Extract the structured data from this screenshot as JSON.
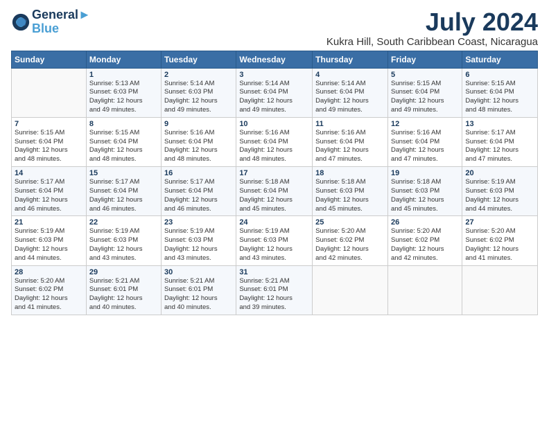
{
  "logo": {
    "line1": "General",
    "line2": "Blue"
  },
  "title": "July 2024",
  "location": "Kukra Hill, South Caribbean Coast, Nicaragua",
  "days_of_week": [
    "Sunday",
    "Monday",
    "Tuesday",
    "Wednesday",
    "Thursday",
    "Friday",
    "Saturday"
  ],
  "weeks": [
    [
      {
        "day": "",
        "sunrise": "",
        "sunset": "",
        "daylight": ""
      },
      {
        "day": "1",
        "sunrise": "Sunrise: 5:13 AM",
        "sunset": "Sunset: 6:03 PM",
        "daylight": "Daylight: 12 hours and 49 minutes."
      },
      {
        "day": "2",
        "sunrise": "Sunrise: 5:14 AM",
        "sunset": "Sunset: 6:03 PM",
        "daylight": "Daylight: 12 hours and 49 minutes."
      },
      {
        "day": "3",
        "sunrise": "Sunrise: 5:14 AM",
        "sunset": "Sunset: 6:04 PM",
        "daylight": "Daylight: 12 hours and 49 minutes."
      },
      {
        "day": "4",
        "sunrise": "Sunrise: 5:14 AM",
        "sunset": "Sunset: 6:04 PM",
        "daylight": "Daylight: 12 hours and 49 minutes."
      },
      {
        "day": "5",
        "sunrise": "Sunrise: 5:15 AM",
        "sunset": "Sunset: 6:04 PM",
        "daylight": "Daylight: 12 hours and 49 minutes."
      },
      {
        "day": "6",
        "sunrise": "Sunrise: 5:15 AM",
        "sunset": "Sunset: 6:04 PM",
        "daylight": "Daylight: 12 hours and 48 minutes."
      }
    ],
    [
      {
        "day": "7",
        "sunrise": "Sunrise: 5:15 AM",
        "sunset": "Sunset: 6:04 PM",
        "daylight": "Daylight: 12 hours and 48 minutes."
      },
      {
        "day": "8",
        "sunrise": "Sunrise: 5:15 AM",
        "sunset": "Sunset: 6:04 PM",
        "daylight": "Daylight: 12 hours and 48 minutes."
      },
      {
        "day": "9",
        "sunrise": "Sunrise: 5:16 AM",
        "sunset": "Sunset: 6:04 PM",
        "daylight": "Daylight: 12 hours and 48 minutes."
      },
      {
        "day": "10",
        "sunrise": "Sunrise: 5:16 AM",
        "sunset": "Sunset: 6:04 PM",
        "daylight": "Daylight: 12 hours and 48 minutes."
      },
      {
        "day": "11",
        "sunrise": "Sunrise: 5:16 AM",
        "sunset": "Sunset: 6:04 PM",
        "daylight": "Daylight: 12 hours and 47 minutes."
      },
      {
        "day": "12",
        "sunrise": "Sunrise: 5:16 AM",
        "sunset": "Sunset: 6:04 PM",
        "daylight": "Daylight: 12 hours and 47 minutes."
      },
      {
        "day": "13",
        "sunrise": "Sunrise: 5:17 AM",
        "sunset": "Sunset: 6:04 PM",
        "daylight": "Daylight: 12 hours and 47 minutes."
      }
    ],
    [
      {
        "day": "14",
        "sunrise": "Sunrise: 5:17 AM",
        "sunset": "Sunset: 6:04 PM",
        "daylight": "Daylight: 12 hours and 46 minutes."
      },
      {
        "day": "15",
        "sunrise": "Sunrise: 5:17 AM",
        "sunset": "Sunset: 6:04 PM",
        "daylight": "Daylight: 12 hours and 46 minutes."
      },
      {
        "day": "16",
        "sunrise": "Sunrise: 5:17 AM",
        "sunset": "Sunset: 6:04 PM",
        "daylight": "Daylight: 12 hours and 46 minutes."
      },
      {
        "day": "17",
        "sunrise": "Sunrise: 5:18 AM",
        "sunset": "Sunset: 6:04 PM",
        "daylight": "Daylight: 12 hours and 45 minutes."
      },
      {
        "day": "18",
        "sunrise": "Sunrise: 5:18 AM",
        "sunset": "Sunset: 6:03 PM",
        "daylight": "Daylight: 12 hours and 45 minutes."
      },
      {
        "day": "19",
        "sunrise": "Sunrise: 5:18 AM",
        "sunset": "Sunset: 6:03 PM",
        "daylight": "Daylight: 12 hours and 45 minutes."
      },
      {
        "day": "20",
        "sunrise": "Sunrise: 5:19 AM",
        "sunset": "Sunset: 6:03 PM",
        "daylight": "Daylight: 12 hours and 44 minutes."
      }
    ],
    [
      {
        "day": "21",
        "sunrise": "Sunrise: 5:19 AM",
        "sunset": "Sunset: 6:03 PM",
        "daylight": "Daylight: 12 hours and 44 minutes."
      },
      {
        "day": "22",
        "sunrise": "Sunrise: 5:19 AM",
        "sunset": "Sunset: 6:03 PM",
        "daylight": "Daylight: 12 hours and 43 minutes."
      },
      {
        "day": "23",
        "sunrise": "Sunrise: 5:19 AM",
        "sunset": "Sunset: 6:03 PM",
        "daylight": "Daylight: 12 hours and 43 minutes."
      },
      {
        "day": "24",
        "sunrise": "Sunrise: 5:19 AM",
        "sunset": "Sunset: 6:03 PM",
        "daylight": "Daylight: 12 hours and 43 minutes."
      },
      {
        "day": "25",
        "sunrise": "Sunrise: 5:20 AM",
        "sunset": "Sunset: 6:02 PM",
        "daylight": "Daylight: 12 hours and 42 minutes."
      },
      {
        "day": "26",
        "sunrise": "Sunrise: 5:20 AM",
        "sunset": "Sunset: 6:02 PM",
        "daylight": "Daylight: 12 hours and 42 minutes."
      },
      {
        "day": "27",
        "sunrise": "Sunrise: 5:20 AM",
        "sunset": "Sunset: 6:02 PM",
        "daylight": "Daylight: 12 hours and 41 minutes."
      }
    ],
    [
      {
        "day": "28",
        "sunrise": "Sunrise: 5:20 AM",
        "sunset": "Sunset: 6:02 PM",
        "daylight": "Daylight: 12 hours and 41 minutes."
      },
      {
        "day": "29",
        "sunrise": "Sunrise: 5:21 AM",
        "sunset": "Sunset: 6:01 PM",
        "daylight": "Daylight: 12 hours and 40 minutes."
      },
      {
        "day": "30",
        "sunrise": "Sunrise: 5:21 AM",
        "sunset": "Sunset: 6:01 PM",
        "daylight": "Daylight: 12 hours and 40 minutes."
      },
      {
        "day": "31",
        "sunrise": "Sunrise: 5:21 AM",
        "sunset": "Sunset: 6:01 PM",
        "daylight": "Daylight: 12 hours and 39 minutes."
      },
      {
        "day": "",
        "sunrise": "",
        "sunset": "",
        "daylight": ""
      },
      {
        "day": "",
        "sunrise": "",
        "sunset": "",
        "daylight": ""
      },
      {
        "day": "",
        "sunrise": "",
        "sunset": "",
        "daylight": ""
      }
    ]
  ]
}
